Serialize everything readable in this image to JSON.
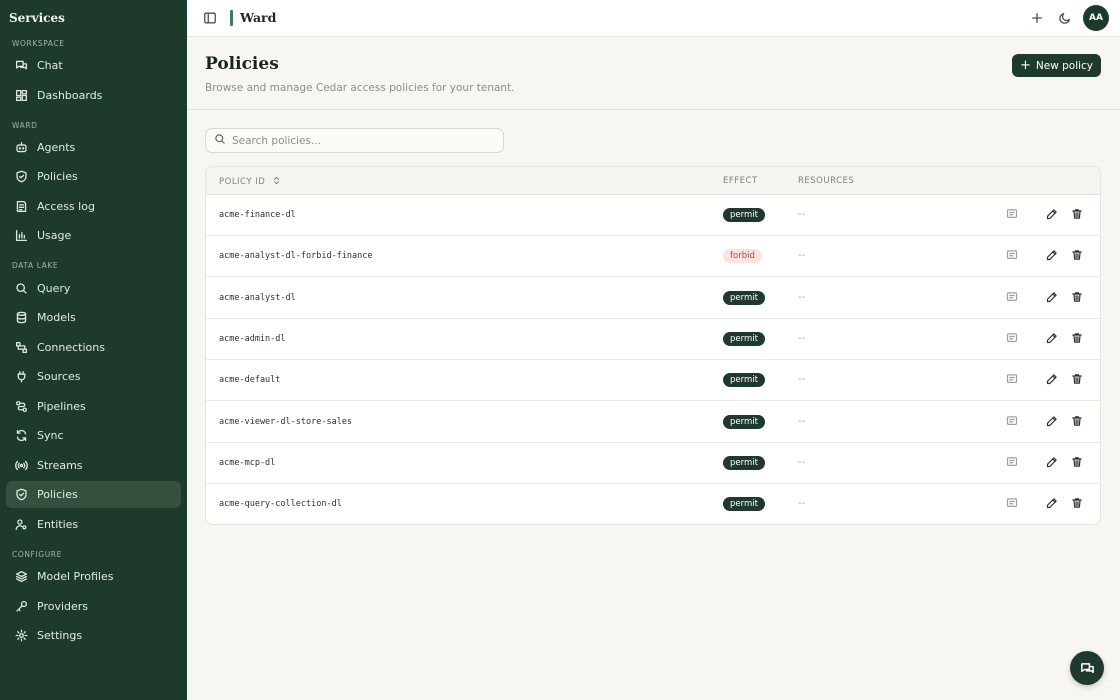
{
  "sidebar": {
    "brand": "Services",
    "sections": [
      {
        "title": "WORKSPACE",
        "items": [
          {
            "label": "Chat",
            "icon": "chat-icon"
          },
          {
            "label": "Dashboards",
            "icon": "dashboard-icon"
          }
        ]
      },
      {
        "title": "WARD",
        "items": [
          {
            "label": "Agents",
            "icon": "bot-icon"
          },
          {
            "label": "Policies",
            "icon": "shield-icon"
          },
          {
            "label": "Access log",
            "icon": "log-icon"
          },
          {
            "label": "Usage",
            "icon": "bar-chart-icon"
          }
        ]
      },
      {
        "title": "DATA LAKE",
        "items": [
          {
            "label": "Query",
            "icon": "search-icon"
          },
          {
            "label": "Models",
            "icon": "database-icon"
          },
          {
            "label": "Connections",
            "icon": "connections-icon"
          },
          {
            "label": "Sources",
            "icon": "plug-icon"
          },
          {
            "label": "Pipelines",
            "icon": "pipeline-icon"
          },
          {
            "label": "Sync",
            "icon": "sync-icon"
          },
          {
            "label": "Streams",
            "icon": "broadcast-icon"
          },
          {
            "label": "Policies",
            "icon": "shield-icon",
            "active": true
          },
          {
            "label": "Entities",
            "icon": "user-settings-icon"
          }
        ]
      },
      {
        "title": "CONFIGURE",
        "items": [
          {
            "label": "Model Profiles",
            "icon": "layers-icon"
          },
          {
            "label": "Providers",
            "icon": "key-icon"
          },
          {
            "label": "Settings",
            "icon": "gear-icon"
          }
        ]
      }
    ]
  },
  "topbar": {
    "title": "Ward",
    "avatar_initials": "AA"
  },
  "header": {
    "title": "Policies",
    "subtitle": "Browse and manage Cedar access policies for your tenant.",
    "new_button_label": "New policy"
  },
  "search": {
    "placeholder": "Search policies...",
    "value": ""
  },
  "table": {
    "columns": [
      "POLICY ID",
      "EFFECT",
      "RESOURCES"
    ],
    "rows": [
      {
        "id": "acme-finance-dl",
        "effect": "permit",
        "resources": "--"
      },
      {
        "id": "acme-analyst-dl-forbid-finance",
        "effect": "forbid",
        "resources": "--"
      },
      {
        "id": "acme-analyst-dl",
        "effect": "permit",
        "resources": "--"
      },
      {
        "id": "acme-admin-dl",
        "effect": "permit",
        "resources": "--"
      },
      {
        "id": "acme-default",
        "effect": "permit",
        "resources": "--"
      },
      {
        "id": "acme-viewer-dl-store-sales",
        "effect": "permit",
        "resources": "--"
      },
      {
        "id": "acme-mcp-dl",
        "effect": "permit",
        "resources": "--"
      },
      {
        "id": "acme-query-collection-dl",
        "effect": "permit",
        "resources": "--"
      }
    ]
  },
  "colors": {
    "sidebar_bg": "#1e3a2c",
    "accent": "#3c7d5a",
    "permit_bg": "#1e3a2c",
    "forbid_bg": "#fbe3e1",
    "forbid_text": "#c0433b",
    "page_bg": "#f7f6f1"
  }
}
